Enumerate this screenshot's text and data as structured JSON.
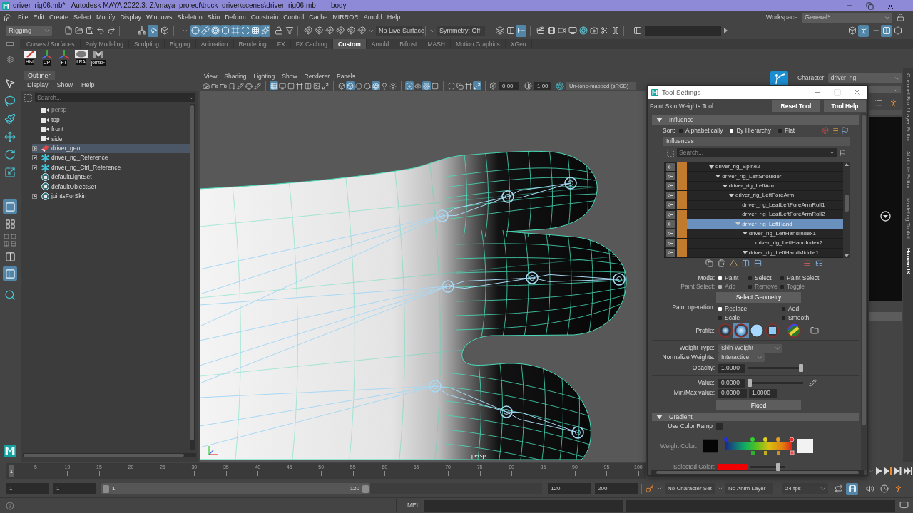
{
  "title_bar": {
    "title": "driver_rig06.mb* - Autodesk MAYA 2022.3: Z:\\maya_project\\truck_driver\\scenes\\driver_rig06.mb  ---  body"
  },
  "menu_bar": {
    "items": [
      "File",
      "Edit",
      "Create",
      "Select",
      "Modify",
      "Display",
      "Windows",
      "Skeleton",
      "Skin",
      "Deform",
      "Constrain",
      "Control",
      "Cache",
      "MIRROR",
      "Arnold",
      "Help"
    ],
    "workspace_label": "Workspace:",
    "workspace": "General*"
  },
  "status_line": {
    "menu_set": "Rigging",
    "select_mode_buttons": [
      {
        "on": false
      },
      {
        "on": true
      },
      {
        "on": false
      }
    ],
    "mask_buttons": [
      {
        "on": true
      },
      {
        "on": true
      },
      {
        "on": true
      },
      {
        "on": true
      },
      {
        "on": true
      },
      {
        "on": true
      },
      {
        "on": true
      },
      {
        "on": true
      }
    ],
    "live_surface": "No Live Surface",
    "symmetry": "Symmetry: Off",
    "history_buttons": [
      {
        "on": false
      },
      {
        "on": false
      },
      {
        "on": true
      }
    ],
    "panel_buttons": [
      {
        "on": false
      },
      {
        "on": true
      },
      {
        "on": false
      },
      {
        "on": true
      },
      {
        "on": false
      }
    ]
  },
  "shelf": {
    "tabs": [
      {
        "label": "Curves / Surfaces",
        "selected": false
      },
      {
        "label": "Poly Modeling",
        "selected": false
      },
      {
        "label": "Sculpting",
        "selected": false
      },
      {
        "label": "Rigging",
        "selected": false
      },
      {
        "label": "Animation",
        "selected": false
      },
      {
        "label": "Rendering",
        "selected": false
      },
      {
        "label": "FX",
        "selected": false
      },
      {
        "label": "FX Caching",
        "selected": false
      },
      {
        "label": "Custom",
        "selected": true
      },
      {
        "label": "Arnold",
        "selected": false
      },
      {
        "label": "Bifrost",
        "selected": false
      },
      {
        "label": "MASH",
        "selected": false
      },
      {
        "label": "Motion Graphics",
        "selected": false
      },
      {
        "label": "XGen",
        "selected": false
      }
    ],
    "buttons": [
      {
        "label": "Hist"
      },
      {
        "label": "CP"
      },
      {
        "label": "FT"
      },
      {
        "label": "LRA"
      },
      {
        "label": "jointsF"
      }
    ]
  },
  "toolbox": {
    "layout_buttons": [
      {
        "on": true
      },
      {
        "on": false
      },
      {
        "on": false
      },
      {
        "on": true
      }
    ]
  },
  "outliner": {
    "title": "Outliner",
    "menus": [
      "Display",
      "Show",
      "Help"
    ],
    "search_placeholder": "Search...",
    "items": [
      {
        "label": "persp",
        "kind": "camera",
        "hidden": true,
        "expandable": false,
        "selected": false
      },
      {
        "label": "top",
        "kind": "camera",
        "hidden": false,
        "expandable": false,
        "selected": false
      },
      {
        "label": "front",
        "kind": "camera",
        "hidden": false,
        "expandable": false,
        "selected": false
      },
      {
        "label": "side",
        "kind": "camera",
        "hidden": false,
        "expandable": false,
        "selected": false
      },
      {
        "label": "driver_geo",
        "kind": "mesh",
        "hidden": false,
        "expandable": true,
        "selected": true
      },
      {
        "label": "driver_rig_Reference",
        "kind": "reference",
        "hidden": false,
        "expandable": true,
        "selected": false
      },
      {
        "label": "driver_rig_Ctrl_Reference",
        "kind": "reference",
        "hidden": false,
        "expandable": true,
        "selected": false
      },
      {
        "label": "defaultLightSet",
        "kind": "set",
        "hidden": false,
        "expandable": false,
        "selected": false
      },
      {
        "label": "defaultObjectSet",
        "kind": "set",
        "hidden": false,
        "expandable": false,
        "selected": false
      },
      {
        "label": "jointsForSkin",
        "kind": "set",
        "hidden": false,
        "expandable": true,
        "selected": false
      }
    ]
  },
  "viewport": {
    "menus": [
      "View",
      "Shading",
      "Lighting",
      "Show",
      "Renderer",
      "Panels"
    ],
    "toolbar_buttons": [
      {
        "on": false
      },
      {
        "on": false
      },
      {
        "on": false
      },
      {
        "on": false
      },
      {
        "on": false
      },
      {
        "on": false
      },
      {
        "on": false
      },
      {
        "on": true
      },
      {
        "on": false
      },
      {
        "on": false
      },
      {
        "on": false
      },
      {
        "on": false
      },
      {
        "on": false
      },
      {
        "on": false
      },
      {
        "on": false
      },
      {
        "on": true
      },
      {
        "on": false
      },
      {
        "on": false
      },
      {
        "on": true
      },
      {
        "on": false
      },
      {
        "on": false
      },
      {
        "on": true
      },
      {
        "on": false
      },
      {
        "on": true
      },
      {
        "on": false
      },
      {
        "on": false
      },
      {
        "on": false
      },
      {
        "on": false
      },
      {
        "on": true
      }
    ],
    "exposure": "0.00",
    "gamma": "1.00",
    "color_space": "Un-tone-mapped (sRGB)",
    "camera_label": "persp"
  },
  "side_panel": {
    "character_label": "Character:",
    "character": "driver_rig",
    "tabs": [
      {
        "label": "Channel Box / Layer Editor",
        "selected": false
      },
      {
        "label": "Attribute Editor",
        "selected": false
      },
      {
        "label": "Modeling Toolkit",
        "selected": false
      },
      {
        "label": "Human IK",
        "selected": true
      }
    ]
  },
  "tool_settings": {
    "title": "Tool Settings",
    "tool_name": "Paint Skin Weights Tool",
    "reset_button": "Reset Tool",
    "help_button": "Tool Help",
    "influence_section": {
      "title": "Influence",
      "expanded": true,
      "sort_label": "Sort:",
      "sort_options": [
        {
          "label": "Alphabetically",
          "selected": false
        },
        {
          "label": "By Hierarchy",
          "selected": true
        },
        {
          "label": "Flat",
          "selected": false
        }
      ],
      "list_title": "Influences",
      "search_placeholder": "Search...",
      "tree": [
        {
          "label": "driver_rig_Spine2",
          "expanded": true,
          "selected": false,
          "children": [
            {
              "label": "driver_rig_LeftShoulder",
              "expanded": true,
              "selected": false,
              "children": [
                {
                  "label": "driver_rig_LeftArm",
                  "expanded": true,
                  "selected": false,
                  "children": [
                    {
                      "label": "driver_rig_LeftForeArm",
                      "expanded": true,
                      "selected": false,
                      "children": [
                        {
                          "label": "driver_rig_LeafLeftForeArmRoll1",
                          "selected": false
                        },
                        {
                          "label": "driver_rig_LeafLeftForeArmRoll2",
                          "selected": false
                        },
                        {
                          "label": "driver_rig_LeftHand",
                          "expanded": true,
                          "selected": true,
                          "children": [
                            {
                              "label": "driver_rig_LeftHandIndex1",
                              "expanded": true,
                              "selected": false,
                              "children": [
                                {
                                  "label": "driver_rig_LeftHandIndex2",
                                  "selected": false
                                }
                              ]
                            },
                            {
                              "label": "driver_rig_LeftHandMiddle1",
                              "expanded": true,
                              "selected": false
                            }
                          ]
                        }
                      ]
                    }
                  ]
                }
              ]
            }
          ]
        }
      ]
    },
    "mode": {
      "label": "Mode:",
      "options": [
        {
          "label": "Paint",
          "selected": true
        },
        {
          "label": "Select",
          "selected": false
        },
        {
          "label": "Paint Select",
          "selected": false
        }
      ]
    },
    "paint_select": {
      "label": "Paint Select:",
      "disabled": true,
      "options": [
        {
          "label": "Add",
          "selected": true
        },
        {
          "label": "Remove",
          "selected": false
        },
        {
          "label": "Toggle",
          "selected": false
        }
      ]
    },
    "select_geometry_button": "Select Geometry",
    "paint_operation": {
      "label": "Paint operation:",
      "options": [
        {
          "label": "Replace",
          "selected": true
        },
        {
          "label": "Add",
          "selected": false
        },
        {
          "label": "Scale",
          "selected": false
        },
        {
          "label": "Smooth",
          "selected": false
        }
      ]
    },
    "profile": {
      "label": "Profile:",
      "brushes": [
        {
          "selected": false
        },
        {
          "selected": true
        },
        {
          "selected": false
        },
        {
          "selected": false
        },
        {
          "selected": false
        }
      ]
    },
    "weight_type": {
      "label": "Weight Type:",
      "value": "Skin Weight"
    },
    "normalize_weights": {
      "label": "Normalize Weights:",
      "value": "Interactive"
    },
    "opacity": {
      "label": "Opacity:",
      "value": "1.0000",
      "level": 1
    },
    "value": {
      "label": "Value:",
      "value": "0.0000",
      "level": 0
    },
    "min_max": {
      "label": "Min/Max value:",
      "min": "0.0000",
      "max": "1.0000"
    },
    "flood_button": "Flood",
    "gradient_section": {
      "title": "Gradient",
      "expanded": true,
      "use_color_ramp": {
        "label": "Use Color Ramp",
        "checked": false
      },
      "weight_color": {
        "label": "Weight Color:",
        "disabled": true
      },
      "selected_color": {
        "label": "Selected Color:",
        "disabled": true,
        "level": 0.85
      }
    }
  },
  "timeline": {
    "current_frame": "1",
    "level": 0,
    "tick_labels": [
      "5",
      "10",
      "15",
      "20",
      "25",
      "30",
      "35",
      "40",
      "45",
      "50",
      "55",
      "60",
      "65",
      "70",
      "75",
      "80",
      "85",
      "90",
      "95",
      "100"
    ]
  },
  "range_slider": {
    "start": "1",
    "playback_start": "1",
    "range_start_label": "1",
    "range_end_label": "120",
    "level": 0.61,
    "playback_end": "120",
    "end": "200",
    "character_set": "No Character Set",
    "anim_layer": "No Anim Layer",
    "fps": "24 fps",
    "toggle_buttons": [
      {
        "on": false
      },
      {
        "on": true
      }
    ]
  },
  "command_line": {
    "language": "MEL"
  }
}
